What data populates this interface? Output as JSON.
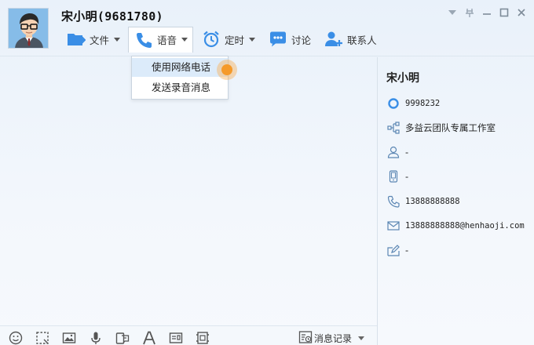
{
  "contact": {
    "name_header": "宋小明(9681780)",
    "avatar_icon": "cartoon-man-avatar"
  },
  "window_controls": [
    "dropdown-arrow-icon",
    "pin-icon",
    "minimize-icon",
    "maximize-icon",
    "close-icon"
  ],
  "toolbar": {
    "file_label": "文件",
    "voice_label": "语音",
    "schedule_label": "定时",
    "discuss_label": "讨论",
    "contacts_label": "联系人"
  },
  "voice_menu": {
    "items": [
      "使用网络电话",
      "发送录音消息"
    ],
    "highlighted_index": 0
  },
  "profile": {
    "name": "宋小明",
    "id": "9998232",
    "org": "多益云团队专属工作室",
    "field_person": "-",
    "field_device": "-",
    "phone": "13888888888",
    "email": "13888888888@henhaoji.com",
    "signature": "-"
  },
  "bottom": {
    "history_label": "消息记录",
    "icons": [
      "emoji-icon",
      "screenshot-icon",
      "image-icon",
      "microphone-icon",
      "phrases-icon",
      "font-icon",
      "card-icon",
      "crop-icon"
    ]
  },
  "colors": {
    "accent": "#3a8ee6",
    "highlight": "#dcebfa",
    "cursor": "#f59a2a"
  }
}
